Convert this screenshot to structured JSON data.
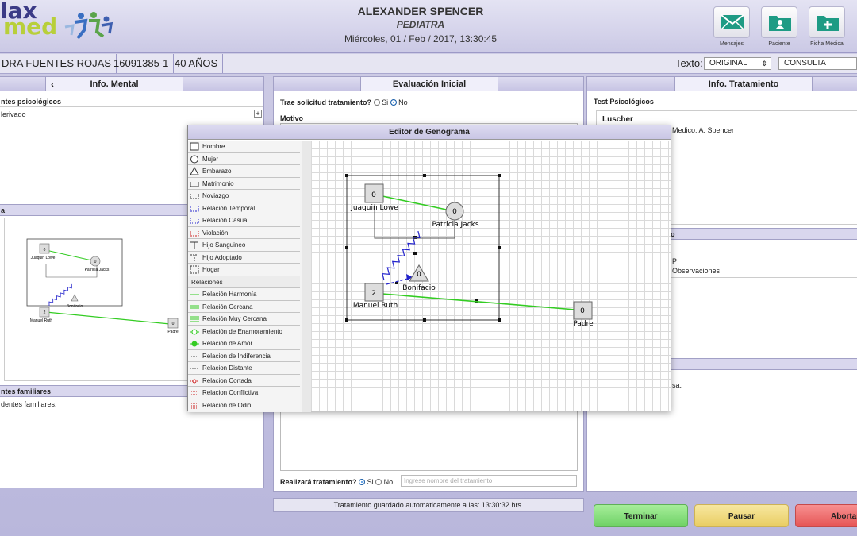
{
  "header": {
    "logo_line1": "lax",
    "logo_line2": "med",
    "doctor_name": "ALEXANDER SPENCER",
    "specialty": "PEDIATRA",
    "datetime": "Miércoles, 01 / Feb / 2017, 13:30:45",
    "buttons": [
      {
        "label": "Mensajes",
        "icon": "envelope-icon"
      },
      {
        "label": "Paciente",
        "icon": "patient-folder-icon"
      },
      {
        "label": "Ficha Médica",
        "icon": "medical-folder-plus-icon"
      }
    ]
  },
  "patient": {
    "name": "DRA FUENTES ROJAS",
    "id": "16091385-1",
    "age": "40 AÑOS",
    "texto_label": "Texto:",
    "texto_value": "ORIGINAL",
    "mode_value": "CONSULTA"
  },
  "left_panel": {
    "tab": "Info. Mental",
    "section1": "ntes psicológicos",
    "text1": "lerivado",
    "section2": "a",
    "section3": "ntes familiares",
    "text3": "dentes familiares."
  },
  "center_panel": {
    "tab": "Evaluación Inicial",
    "question": "Trae solicitud tratamiento?",
    "yes": "Si",
    "no": "No",
    "motivo": "Motivo",
    "realizara": "Realizará tratamiento?",
    "placeholder": "Ingrese nombre del tratamiento"
  },
  "right_panel": {
    "tab": "Info. Tratamiento",
    "section1": "Test Psicológicos",
    "test_name": "Luscher",
    "medico": "Medico: A. Spencer",
    "frag2": "o",
    "frag3": "P",
    "frag4": "Observaciones",
    "frag5": "sa."
  },
  "genograma": {
    "title": "Editor de Genograma",
    "palette": [
      {
        "label": "Hombre",
        "icon": "square-icon"
      },
      {
        "label": "Mujer",
        "icon": "circle-icon"
      },
      {
        "label": "Embarazo",
        "icon": "triangle-icon"
      },
      {
        "label": "Matrimonio",
        "icon": "marriage-icon"
      },
      {
        "label": "Noviazgo",
        "icon": "engagement-icon"
      },
      {
        "label": "Relacion Temporal",
        "icon": "temporal-relation-icon"
      },
      {
        "label": "Relacion Casual",
        "icon": "casual-relation-icon"
      },
      {
        "label": "Violación",
        "icon": "violation-icon"
      },
      {
        "label": "Hijo Sanguineo",
        "icon": "blood-child-icon"
      },
      {
        "label": "Hijo Adoptado",
        "icon": "adopted-child-icon"
      },
      {
        "label": "Hogar",
        "icon": "home-icon"
      },
      {
        "label": "Relaciones",
        "icon": ""
      },
      {
        "label": "Relación Harmonía",
        "icon": "harmony-line-icon"
      },
      {
        "label": "Relación Cercana",
        "icon": "close-line-icon"
      },
      {
        "label": "Relación Muy Cercana",
        "icon": "very-close-line-icon"
      },
      {
        "label": "Relación de Enamoramiento",
        "icon": "infatuation-line-icon"
      },
      {
        "label": "Relación de Amor",
        "icon": "love-line-icon"
      },
      {
        "label": "Relacion de Indiferencia",
        "icon": "indifference-line-icon"
      },
      {
        "label": "Relacion Distante",
        "icon": "distant-line-icon"
      },
      {
        "label": "Relacion Cortada",
        "icon": "cut-line-icon"
      },
      {
        "label": "Relacion Conflictiva",
        "icon": "conflict-line-icon"
      },
      {
        "label": "Relacion de Odio",
        "icon": "hate-line-icon"
      }
    ],
    "nodes": [
      {
        "name": "Juaquin Lowe",
        "value": "0",
        "shape": "square"
      },
      {
        "name": "Patricia Jacks",
        "value": "0",
        "shape": "circle"
      },
      {
        "name": "Bonifacio",
        "value": "0",
        "shape": "triangle"
      },
      {
        "name": "Manuel Ruth",
        "value": "2",
        "shape": "square"
      },
      {
        "name": "Padre",
        "value": "0",
        "shape": "square"
      }
    ]
  },
  "footer": {
    "status": "Tratamiento guardado automáticamente a las: 13:30:32 hrs.",
    "terminar": "Terminar",
    "pausar": "Pausar",
    "abortar": "Abortar"
  },
  "colors": {
    "accent": "#3b3a86",
    "green_rel": "#33cc22",
    "terminar": "#86e07a",
    "pausar": "#f0d97a",
    "abortar": "#ef6b6b"
  }
}
